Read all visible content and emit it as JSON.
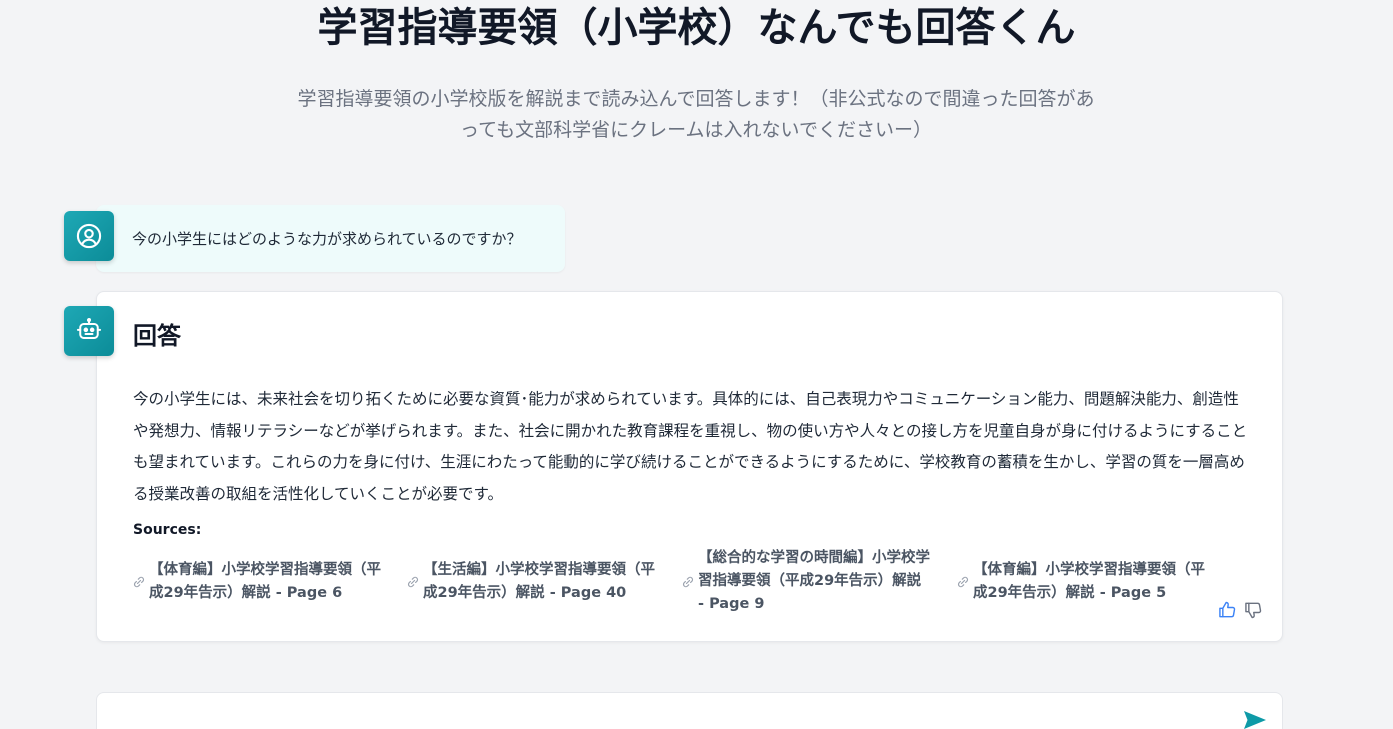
{
  "header": {
    "title": "学習指導要領（小学校）なんでも回答くん",
    "subtitle": "学習指導要領の小学校版を解説まで読み込んで回答します！（非公式なので間違った回答があっても文部科学省にクレームは入れないでくださいー）"
  },
  "user_message": {
    "avatar_icon": "user-circle-icon",
    "text": "今の小学生にはどのような力が求められているのですか？"
  },
  "answer": {
    "avatar_icon": "robot-icon",
    "heading": "回答",
    "body": "今の小学生には、未来社会を切り拓くために必要な資質･能力が求められています。具体的には、自己表現力やコミュニケーション能力、問題解決能力、創造性や発想力、情報リテラシーなどが挙げられます。また、社会に開かれた教育課程を重視し、物の使い方や人々との接し方を児童自身が身に付けるようにすることも望まれています。これらの力を身に付け、生涯にわたって能動的に学び続けることができるようにするために、学校教育の蓄積を生かし、学習の質を一層高める授業改善の取組を活性化していくことが必要です。",
    "sources_label": "Sources:",
    "sources": [
      {
        "label": "【体育編】小学校学習指導要領（平成29年告示）解説 - Page 6"
      },
      {
        "label": "【生活編】小学校学習指導要領（平成29年告示）解説 - Page 40"
      },
      {
        "label": "【総合的な学習の時間編】小学校学習指導要領（平成29年告示）解説 - Page 9"
      },
      {
        "label": "【体育編】小学校学習指導要領（平成29年告示）解説 - Page 5"
      }
    ]
  },
  "input": {
    "value": "",
    "placeholder": ""
  },
  "colors": {
    "accent": "#0f9aa8",
    "background": "#f3f4f6",
    "user_bubble": "#eefbfb",
    "feedback": "#3b82f6",
    "send": "#0e9aa7"
  }
}
